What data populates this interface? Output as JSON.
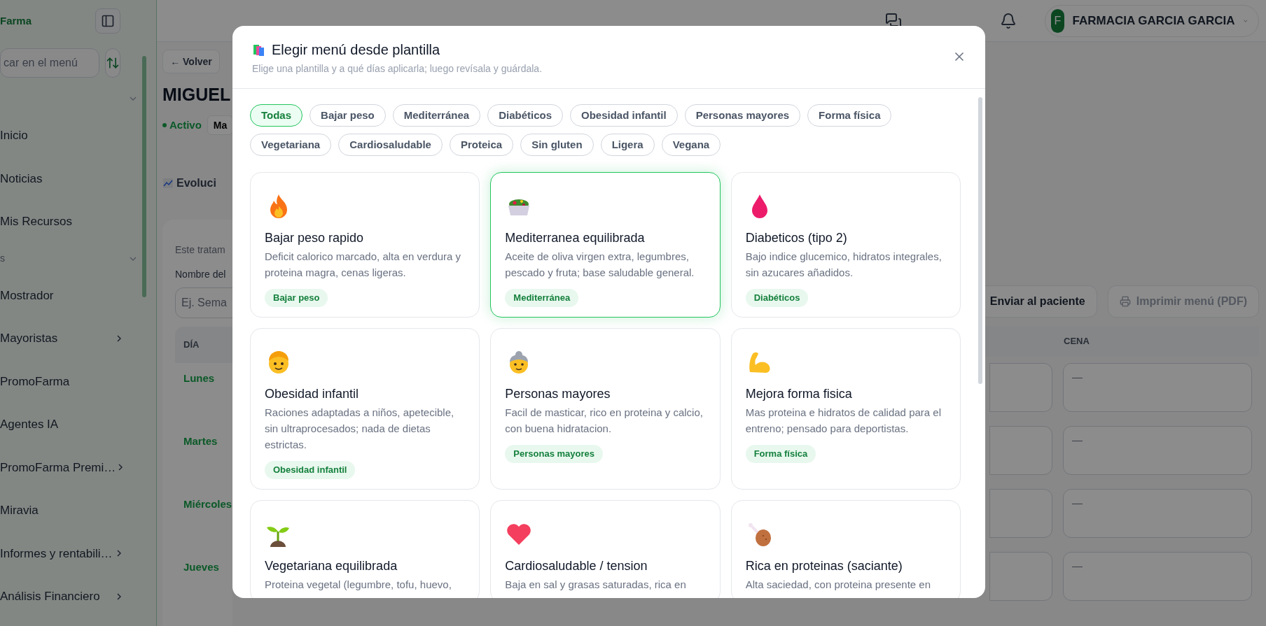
{
  "sidebar": {
    "logo": "Farma",
    "search": {
      "placeholder": "car en el menú"
    },
    "items": [
      {
        "kind": "section_toggle"
      },
      {
        "kind": "link",
        "label": "Inicio",
        "has_submenu": false
      },
      {
        "kind": "link",
        "label": "Noticias",
        "has_submenu": false
      },
      {
        "kind": "link",
        "label": "Mis Recursos",
        "has_submenu": false
      },
      {
        "kind": "section",
        "label": "s"
      },
      {
        "kind": "link",
        "label": "Mostrador",
        "has_submenu": false
      },
      {
        "kind": "link",
        "label": "Mayoristas",
        "has_submenu": true
      },
      {
        "kind": "link",
        "label": "PromoFarma",
        "has_submenu": false
      },
      {
        "kind": "link",
        "label": "Agentes IA",
        "has_submenu": false
      },
      {
        "kind": "link",
        "label": "PromoFarma Premi…",
        "has_submenu": true
      },
      {
        "kind": "link",
        "label": "Miravia",
        "has_submenu": false
      },
      {
        "kind": "link",
        "label": "Informes y rentabili…",
        "has_submenu": true
      },
      {
        "kind": "link",
        "label": "Análisis Financiero",
        "has_submenu": true
      }
    ]
  },
  "topbar": {
    "account": {
      "initial": "F",
      "name": "FARMACIA GARCIA GARCIA"
    }
  },
  "page": {
    "back": "← Volver",
    "title": "MIGUEL",
    "status": "Activo",
    "status_extra": "Ma",
    "tab": "Evoluci",
    "notice": "Este tratam",
    "name_label": "Nombre del",
    "name_placeholder": "Ej. Sema",
    "actions": [
      {
        "label": "Enviar al paciente",
        "disabled": false
      },
      {
        "label": "Imprimir menú (PDF)",
        "disabled": true
      }
    ],
    "table": {
      "columns": [
        "DÍA",
        "CENA"
      ],
      "rows": [
        {
          "day": "Lunes",
          "placeholder": "—"
        },
        {
          "day": "Martes",
          "placeholder": "—"
        },
        {
          "day": "Miércoles",
          "placeholder": "—"
        },
        {
          "day": "Jueves",
          "placeholder": "—"
        }
      ]
    }
  },
  "modal": {
    "title": "Elegir menú desde plantilla",
    "subtitle": "Elige una plantilla y a qué días aplicarla; luego revísala y guárdala.",
    "filters": [
      {
        "label": "Todas",
        "selected": true
      },
      {
        "label": "Bajar peso",
        "selected": false
      },
      {
        "label": "Mediterránea",
        "selected": false
      },
      {
        "label": "Diabéticos",
        "selected": false
      },
      {
        "label": "Obesidad infantil",
        "selected": false
      },
      {
        "label": "Personas mayores",
        "selected": false
      },
      {
        "label": "Forma física",
        "selected": false
      },
      {
        "label": "Vegetariana",
        "selected": false
      },
      {
        "label": "Cardiosaludable",
        "selected": false
      },
      {
        "label": "Proteica",
        "selected": false
      },
      {
        "label": "Sin gluten",
        "selected": false
      },
      {
        "label": "Ligera",
        "selected": false
      },
      {
        "label": "Vegana",
        "selected": false
      }
    ],
    "templates": [
      {
        "kind": "flame",
        "title": "Bajar peso rapido",
        "description": "Deficit calorico marcado, alta en verdura y proteina magra, cenas ligeras.",
        "tag": "Bajar peso",
        "selected": false
      },
      {
        "kind": "salad",
        "title": "Mediterranea equilibrada",
        "description": "Aceite de oliva virgen extra, legumbres, pescado y fruta; base saludable general.",
        "tag": "Mediterránea",
        "selected": true
      },
      {
        "kind": "drop",
        "title": "Diabeticos (tipo 2)",
        "description": "Bajo indice glucemico, hidratos integrales, sin azucares añadidos.",
        "tag": "Diabéticos",
        "selected": false
      },
      {
        "kind": "child",
        "title": "Obesidad infantil",
        "description": "Raciones adaptadas a niños, apetecible, sin ultraprocesados; nada de dietas estrictas.",
        "tag": "Obesidad infantil",
        "selected": false
      },
      {
        "kind": "elder",
        "title": "Personas mayores",
        "description": "Facil de masticar, rico en proteina y calcio, con buena hidratacion.",
        "tag": "Personas mayores",
        "selected": false
      },
      {
        "kind": "arm",
        "title": "Mejora forma fisica",
        "description": "Mas proteina e hidratos de calidad para el entreno; pensado para deportistas.",
        "tag": "Forma física",
        "selected": false
      },
      {
        "kind": "sprout",
        "title": "Vegetariana equilibrada",
        "description": "Proteina vegetal (legumbre, tofu, huevo,",
        "selected": false
      },
      {
        "kind": "heart",
        "title": "Cardiosaludable / tension",
        "description": "Baja en sal y grasas saturadas, rica en",
        "selected": false
      },
      {
        "kind": "drumstick",
        "title": "Rica en proteinas (saciante)",
        "description": "Alta saciedad, con proteina presente en",
        "selected": false
      }
    ]
  }
}
